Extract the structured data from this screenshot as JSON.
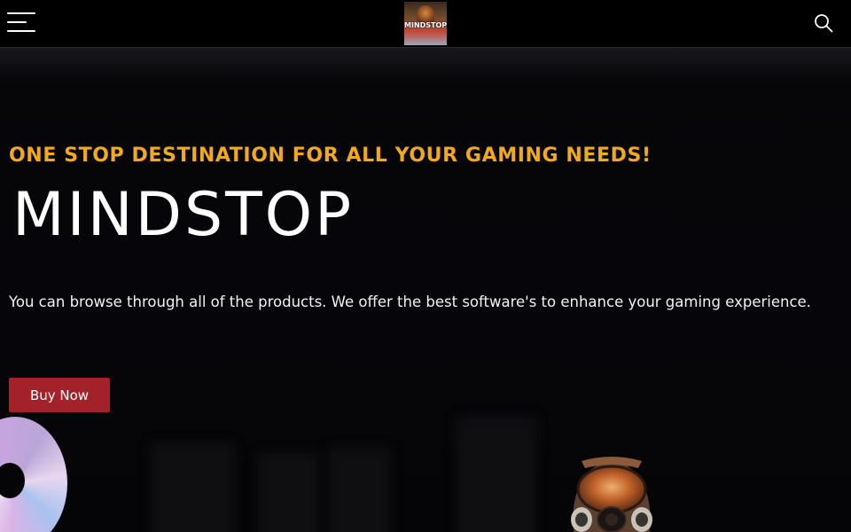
{
  "header": {
    "menu_icon": "hamburger-menu-icon",
    "logo_text": "MINDSTOP",
    "search_icon": "search-icon"
  },
  "hero": {
    "tagline": "ONE STOP DESTINATION FOR ALL YOUR GAMING NEEDS!",
    "title": "MINDSTOP",
    "description": "You can browse through all of the products. We offer the best software's to enhance your gaming experience.",
    "cta_label": "Buy Now"
  },
  "colors": {
    "accent": "#f2a91b",
    "button": "#a3222a",
    "background": "#050508"
  },
  "decor": {
    "disc": "cd-disc-image",
    "mask": "gas-mask-character-image"
  }
}
